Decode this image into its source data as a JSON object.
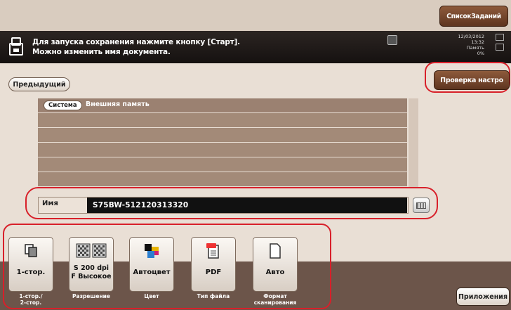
{
  "header": {
    "job_list_label": "СписокЗаданий",
    "message_line1": "Для запуска сохранения нажмите кнопку [Старт].",
    "message_line2": "Можно изменить имя документа.",
    "status_date": "12/03/2012",
    "status_time": "13:32",
    "status_memory_label": "Память",
    "status_memory_value": "0%"
  },
  "nav": {
    "prev_label": "Предыдущий",
    "check_settings_label": "Проверка настро"
  },
  "list": {
    "rows": [
      {
        "tag": "Система",
        "text": "Внешняя память"
      },
      {
        "tag": "",
        "text": ""
      },
      {
        "tag": "",
        "text": ""
      },
      {
        "tag": "",
        "text": ""
      },
      {
        "tag": "",
        "text": ""
      },
      {
        "tag": "",
        "text": ""
      }
    ]
  },
  "name_field": {
    "label": "Имя",
    "value": "S75BW-512120313320"
  },
  "functions": [
    {
      "icon": "simplex-icon",
      "value": "1-стор.",
      "caption": "1-стор./\n2-стор."
    },
    {
      "icon": "resolution-icon",
      "value": "S 200 dpi\nF Высокое",
      "caption": "Разрешение"
    },
    {
      "icon": "color-icon",
      "value": "Автоцвет",
      "caption": "Цвет"
    },
    {
      "icon": "pdf-icon",
      "value": "PDF",
      "caption": "Тип файла"
    },
    {
      "icon": "document-icon",
      "value": "Авто",
      "caption": "Формат\nсканирования"
    }
  ],
  "apps_label": "Приложения",
  "colors": {
    "accent_brown": "#6c554a",
    "highlight_red": "#d8202a"
  }
}
